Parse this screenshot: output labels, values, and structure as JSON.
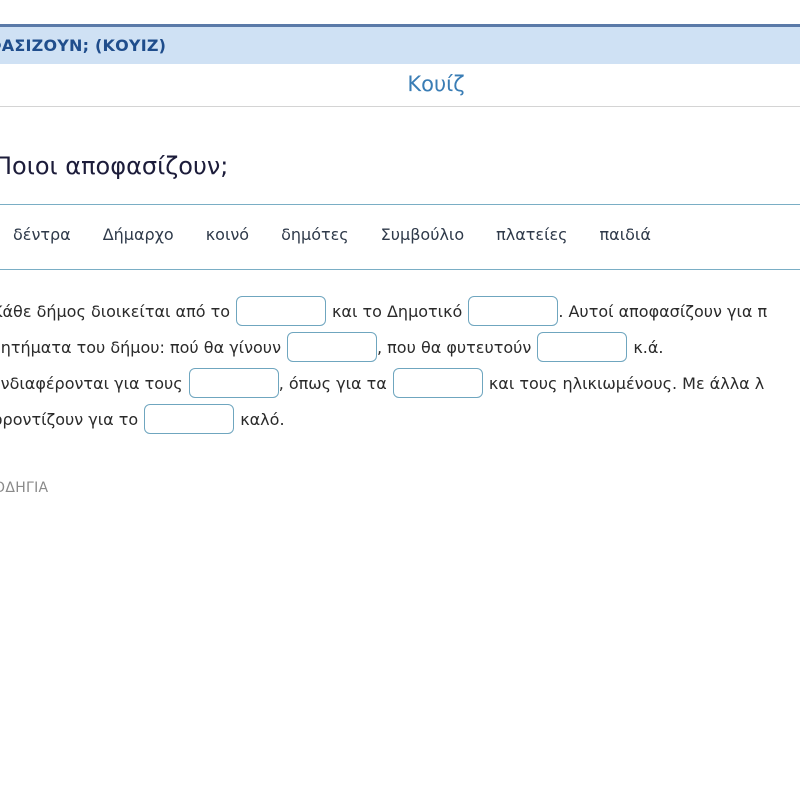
{
  "header": {
    "title": "ΦΑΣΙΖΟΥΝ; (ΚΟΥΙΖ)"
  },
  "tab": {
    "title": "Κουίζ"
  },
  "quiz": {
    "heading": "Ποιοι αποφασίζουν;",
    "word_bank": [
      "δέντρα",
      "Δήμαρχο",
      "κοινό",
      "δημότες",
      "Συμβούλιο",
      "πλατείες",
      "παιδιά"
    ],
    "passage": {
      "l1a": "Κάθε δήμος διοικείται από το",
      "l1b": "και το Δημοτικό",
      "l1c": ". Αυτοί αποφασίζουν για π",
      "l2a": "ζητήματα του δήμου: πού θα γίνουν",
      "l2b": ", που θα φυτευτούν",
      "l2c": "κ.ά.",
      "l3a": "ενδιαφέρονται για τους",
      "l3b": ", όπως για τα",
      "l3c": "και τους ηλικιωμένους. Με άλλα λ",
      "l4a": "φροντίζουν για το",
      "l4b": "καλό."
    },
    "instructions_label": "ΟΔΗΓΙΑ"
  }
}
